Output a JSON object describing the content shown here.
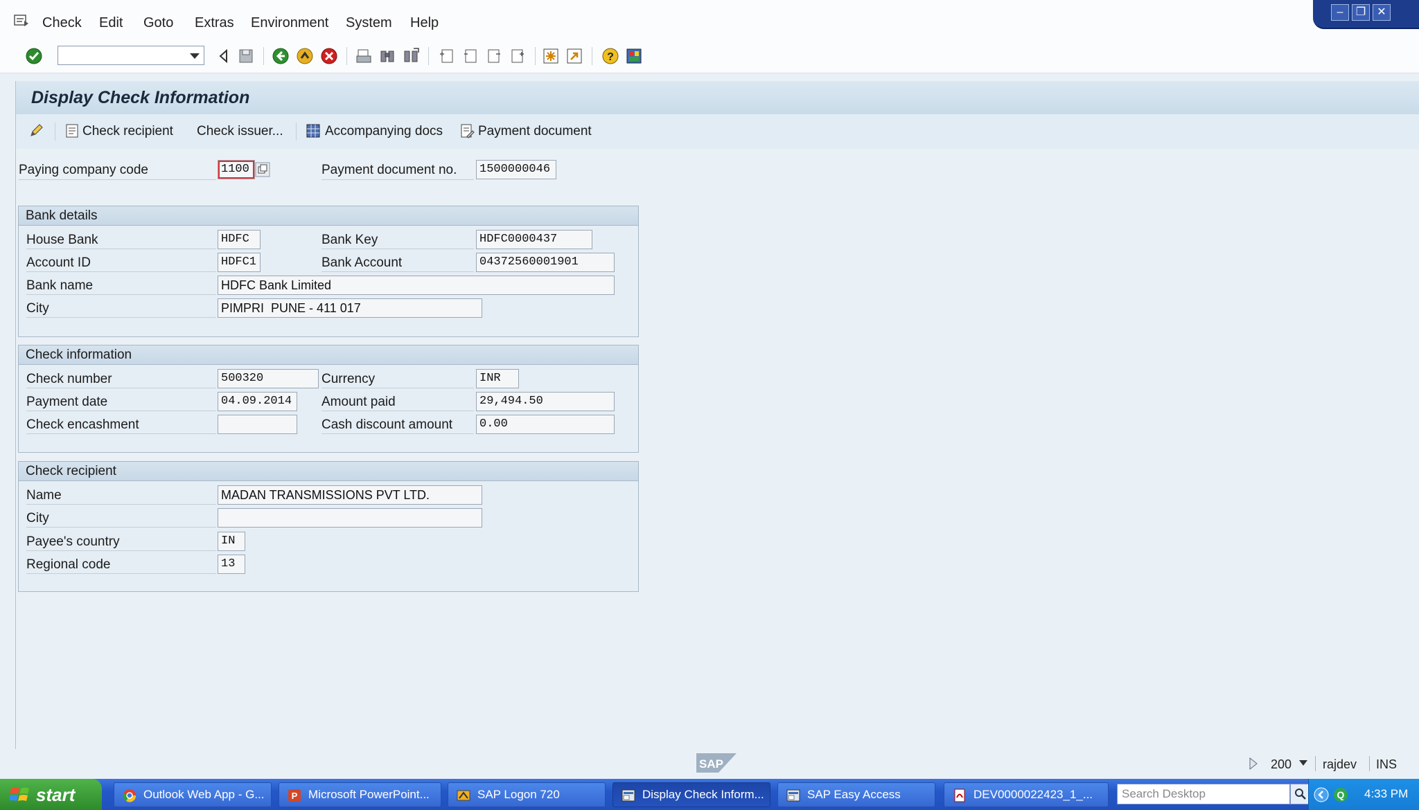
{
  "menubar": {
    "items": [
      "Check",
      "Edit",
      "Goto",
      "Extras",
      "Environment",
      "System",
      "Help"
    ]
  },
  "title": "Display Check Information",
  "app_toolbar": {
    "check_recipient": "Check recipient",
    "check_issuer": "Check issuer...",
    "accompanying_docs": "Accompanying docs",
    "payment_document": "Payment document"
  },
  "header": {
    "paying_company_code_label": "Paying company code",
    "paying_company_code": "1100",
    "payment_document_no_label": "Payment document no.",
    "payment_document_no": "1500000046"
  },
  "bank_details": {
    "title": "Bank details",
    "house_bank_label": "House Bank",
    "house_bank": "HDFC",
    "bank_key_label": "Bank Key",
    "bank_key": "HDFC0000437",
    "account_id_label": "Account ID",
    "account_id": "HDFC1",
    "bank_account_label": "Bank Account",
    "bank_account": "04372560001901",
    "bank_name_label": "Bank name",
    "bank_name": "HDFC Bank Limited",
    "city_label": "City",
    "city": "PIMPRI  PUNE - 411 017"
  },
  "check_information": {
    "title": "Check information",
    "check_number_label": "Check number",
    "check_number": "500320",
    "currency_label": "Currency",
    "currency": "INR",
    "payment_date_label": "Payment date",
    "payment_date": "04.09.2014",
    "amount_paid_label": "Amount paid",
    "amount_paid": "29,494.50",
    "check_encashment_label": "Check encashment",
    "check_encashment": "",
    "cash_discount_label": "Cash discount amount",
    "cash_discount": "0.00"
  },
  "check_recipient": {
    "title": "Check recipient",
    "name_label": "Name",
    "name": "MADAN TRANSMISSIONS PVT LTD.",
    "city_label": "City",
    "city": "",
    "payee_country_label": "Payee's country",
    "payee_country": "IN",
    "regional_code_label": "Regional code",
    "regional_code": "13"
  },
  "statusbar": {
    "client": "200",
    "user": "rajdev",
    "mode": "INS"
  },
  "taskbar": {
    "start": "start",
    "tasks": [
      "Outlook Web App - G...",
      "Microsoft PowerPoint...",
      "SAP Logon 720",
      "Display Check Inform...",
      "SAP Easy Access",
      "DEV0000022423_1_..."
    ],
    "search_placeholder": "Search Desktop",
    "clock": "4:33 PM"
  },
  "colors": {
    "title_band": "#c9dbe9",
    "taskbar": "#2457c7",
    "start_button": "#3a9a35"
  }
}
